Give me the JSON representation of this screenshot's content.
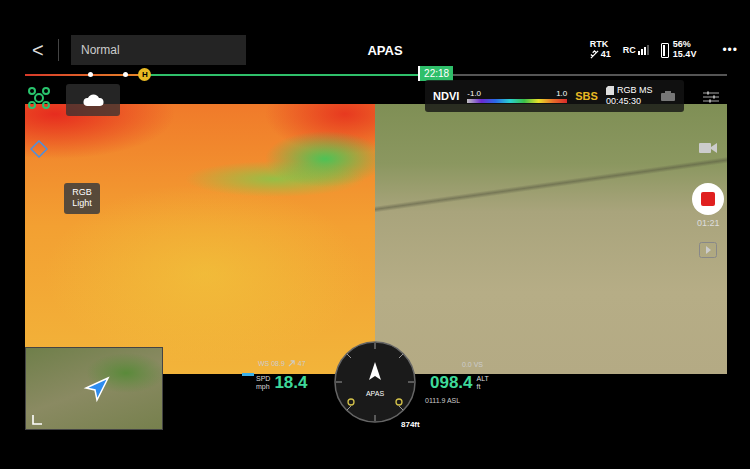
{
  "top_bar": {
    "back": "<",
    "mode": "Normal",
    "title": "APAS",
    "rtk": {
      "label": "RTK",
      "count": "41"
    },
    "rc": {
      "label": "RC",
      "signal_level": 0.75
    },
    "battery": {
      "percent": "56%",
      "voltage": "15.4V",
      "level": 0.56
    },
    "more": "•••"
  },
  "timeline": {
    "home_marker": "H",
    "home_level": 0.17,
    "time": "22:18",
    "level": 0.56
  },
  "camera": {
    "left_label": "RGB Light",
    "legend": {
      "title": "NDVI",
      "min": "-1.0",
      "max": "1.0"
    },
    "mode": "SBS",
    "storage": "RGB MS",
    "remaining": "00:45:30",
    "record_time": "01:21",
    "recording": true
  },
  "telemetry": {
    "wind": "WS 08.9",
    "wind_dir": "47",
    "speed_label_top": "SPD",
    "speed_label_bottom": "mph",
    "speed": "18.4",
    "vs": "0.0 VS",
    "altitude": "098.4",
    "alt_label_top": "ALT",
    "alt_label_bottom": "ft",
    "asl": "0111.9 ASL",
    "compass_label": "APAS",
    "distance": "874ft"
  }
}
